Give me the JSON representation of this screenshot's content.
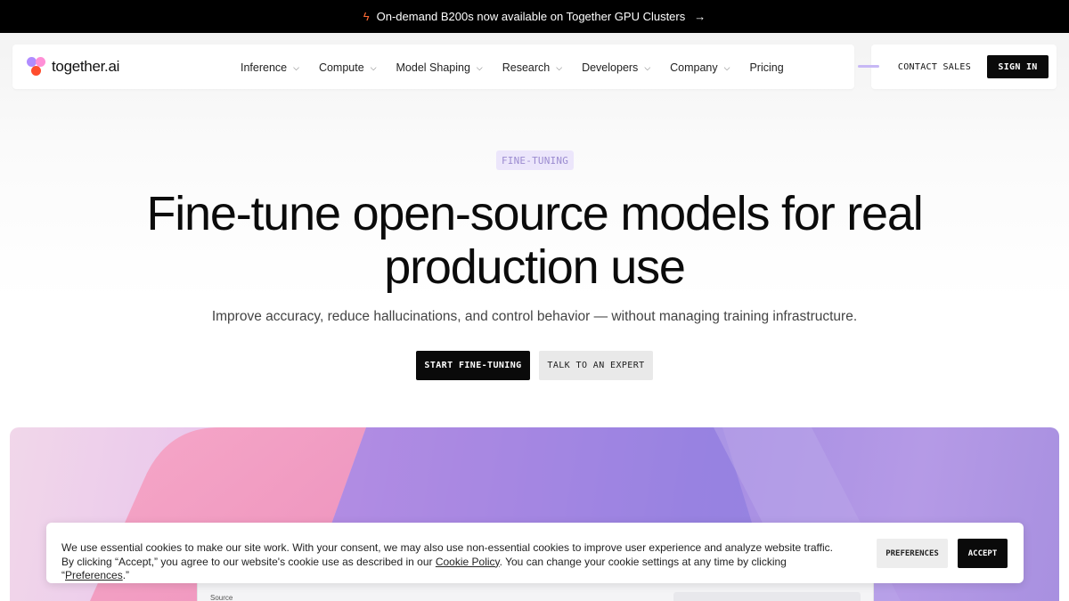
{
  "announcement": {
    "icon": "bolt-icon",
    "text": "On-demand B200s now available on Together GPU Clusters",
    "arrow": "→"
  },
  "brand": {
    "name": "together.ai",
    "colors": [
      "#b08cff",
      "#ff8fd6",
      "#ff4d2e"
    ]
  },
  "nav": {
    "items": [
      {
        "label": "Inference",
        "has_dropdown": true
      },
      {
        "label": "Compute",
        "has_dropdown": true
      },
      {
        "label": "Model Shaping",
        "has_dropdown": true
      },
      {
        "label": "Research",
        "has_dropdown": true
      },
      {
        "label": "Developers",
        "has_dropdown": true
      },
      {
        "label": "Company",
        "has_dropdown": true
      },
      {
        "label": "Pricing",
        "has_dropdown": false
      }
    ],
    "contact_label": "CONTACT SALES",
    "signin_label": "SIGN IN"
  },
  "hero": {
    "badge": "FINE-TUNING",
    "title": "Fine-tune open-source models for real production use",
    "subtitle": "Improve accuracy, reduce hallucinations, and control behavior — without managing training infrastructure.",
    "primary_cta": "START FINE-TUNING",
    "secondary_cta": "TALK TO AN EXPERT"
  },
  "showcase": {
    "source_label": "Source"
  },
  "cookie": {
    "text_1": "We use essential cookies to make our site work. With your consent, we may also use non-essential cookies to improve user experience and analyze website traffic. By clicking “Accept,” you agree to our website's cookie use as described in our ",
    "policy_link": "Cookie Policy",
    "text_2": ". You can change your cookie settings at any time by clicking “",
    "preferences_link": "Preferences",
    "text_3": ".”",
    "preferences_label": "PREFERENCES",
    "accept_label": "ACCEPT"
  },
  "colors": {
    "accent": "#0a0a0a",
    "badge_bg": "#ece6fb",
    "badge_text": "#9b8bd0"
  }
}
